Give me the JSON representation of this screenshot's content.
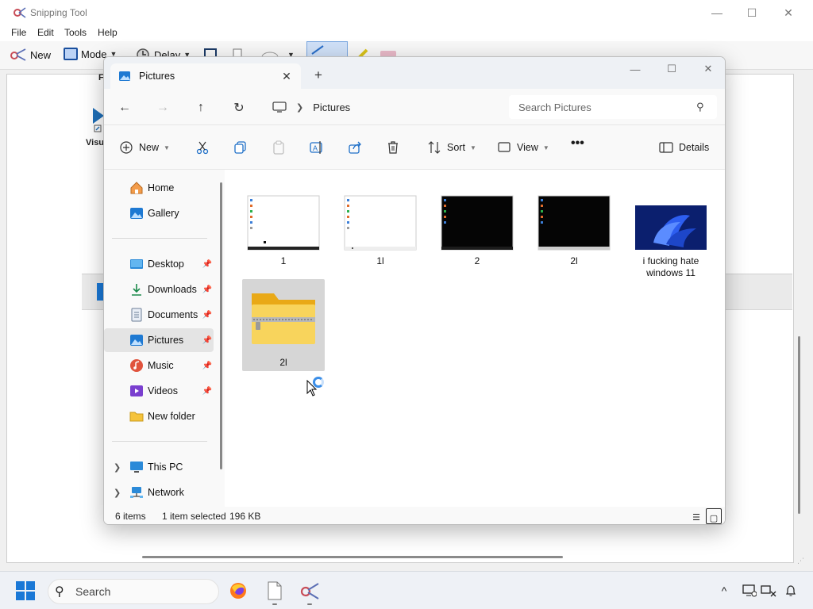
{
  "snipping_tool": {
    "title": "Snipping Tool",
    "menu": [
      "File",
      "Edit",
      "Tools",
      "Help"
    ],
    "toolbar": {
      "new_label": "New",
      "mode_label": "Mode",
      "delay_label": "Delay"
    },
    "desktop_label": "Visu",
    "peek_text": "F"
  },
  "explorer": {
    "tab_title": "Pictures",
    "address": {
      "crumb": "Pictures"
    },
    "search_placeholder": "Search Pictures",
    "commands": {
      "new": "New",
      "sort": "Sort",
      "view": "View",
      "details": "Details"
    },
    "nav": {
      "home": "Home",
      "gallery": "Gallery",
      "desktop": "Desktop",
      "downloads": "Downloads",
      "documents": "Documents",
      "pictures": "Pictures",
      "music": "Music",
      "videos": "Videos",
      "new_folder": "New folder",
      "this_pc": "This PC",
      "network": "Network"
    },
    "files": [
      {
        "name": "1",
        "kind": "screenshot-light"
      },
      {
        "name": "1l",
        "kind": "screenshot-white"
      },
      {
        "name": "2",
        "kind": "screenshot-dark"
      },
      {
        "name": "2l",
        "kind": "screenshot-dark"
      },
      {
        "name": "i fucking hate windows 11",
        "kind": "wallpaper"
      },
      {
        "name": "2l",
        "kind": "zip-folder",
        "selected": true
      }
    ],
    "status": {
      "items": "6 items",
      "selected": "1 item selected",
      "size": "196 KB"
    }
  },
  "taskbar": {
    "search_label": "Search"
  },
  "colors": {
    "accent": "#1a78d6",
    "folder": "#f5c33b",
    "selected_bg": "#d6d6d6"
  }
}
